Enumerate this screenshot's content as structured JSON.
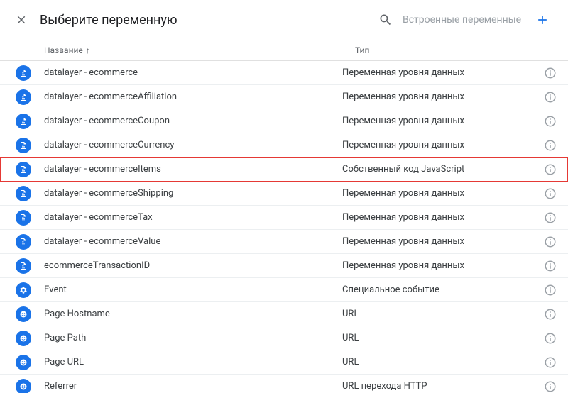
{
  "header": {
    "title": "Выберите переменную",
    "hint": "Встроенные переменные"
  },
  "table": {
    "col_name": "Название",
    "col_type": "Тип",
    "sort_arrow": "↑"
  },
  "rows": [
    {
      "icon": "doc",
      "name": "datalayer - ecommerce",
      "type": "Переменная уровня данных",
      "highlight": false
    },
    {
      "icon": "doc",
      "name": "datalayer - ecommerceAffiliation",
      "type": "Переменная уровня данных",
      "highlight": false
    },
    {
      "icon": "doc",
      "name": "datalayer - ecommerceCoupon",
      "type": "Переменная уровня данных",
      "highlight": false
    },
    {
      "icon": "doc",
      "name": "datalayer - ecommerceCurrency",
      "type": "Переменная уровня данных",
      "highlight": false
    },
    {
      "icon": "doc",
      "name": "datalayer - ecommerceItems",
      "type": "Собственный код JavaScript",
      "highlight": true
    },
    {
      "icon": "doc",
      "name": "datalayer - ecommerceShipping",
      "type": "Переменная уровня данных",
      "highlight": false
    },
    {
      "icon": "doc",
      "name": "datalayer - ecommerceTax",
      "type": "Переменная уровня данных",
      "highlight": false
    },
    {
      "icon": "doc",
      "name": "datalayer - ecommerceValue",
      "type": "Переменная уровня данных",
      "highlight": false
    },
    {
      "icon": "doc",
      "name": "ecommerceTransactionID",
      "type": "Переменная уровня данных",
      "highlight": false
    },
    {
      "icon": "gear",
      "name": "Event",
      "type": "Специальное событие",
      "highlight": false
    },
    {
      "icon": "url",
      "name": "Page Hostname",
      "type": "URL",
      "highlight": false
    },
    {
      "icon": "url",
      "name": "Page Path",
      "type": "URL",
      "highlight": false
    },
    {
      "icon": "url",
      "name": "Page URL",
      "type": "URL",
      "highlight": false
    },
    {
      "icon": "url",
      "name": "Referrer",
      "type": "URL перехода HTTP",
      "highlight": false
    }
  ]
}
